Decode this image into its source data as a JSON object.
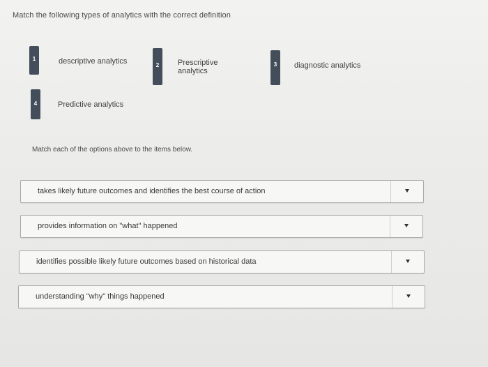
{
  "question": "Match the following types of analytics with the correct definition",
  "options": [
    {
      "number": "1",
      "label_lines": [
        "descriptive analytics"
      ]
    },
    {
      "number": "2",
      "label_lines": [
        "Prescriptive",
        "analytics"
      ]
    },
    {
      "number": "3",
      "label_lines": [
        "diagnostic analytics"
      ]
    },
    {
      "number": "4",
      "label_lines": [
        "Predictive analytics"
      ]
    }
  ],
  "instructions": "Match each of the options above to the items below.",
  "items": [
    {
      "text": "takes likely future outcomes and identifies the best course of action",
      "selected": ""
    },
    {
      "text": "provides information on \"what\" happened",
      "selected": ""
    },
    {
      "text": "identifies possible likely future outcomes based on historical data",
      "selected": ""
    },
    {
      "text": "understanding \"why\" things happened",
      "selected": ""
    }
  ],
  "colors": {
    "tag": "#434e5a",
    "row_border": "#a9a9a9",
    "background": "#ececea"
  },
  "icons": {
    "dropdown": "caret-down-icon"
  }
}
